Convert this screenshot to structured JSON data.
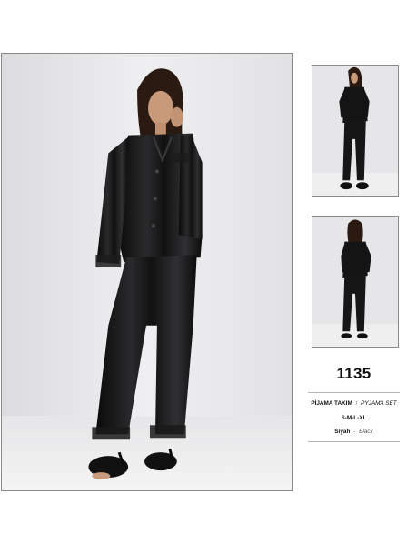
{
  "product": {
    "code": "1135",
    "name_tr": "PİJAMA TAKIM",
    "name_separator": "/",
    "name_en": "PYJAMA SET",
    "sizes": "S-M-L-XL",
    "color_tr": "Siyah",
    "color_separator": "-",
    "color_en": "Black"
  },
  "photos": {
    "main": "model-front-standing",
    "thumbnail_1": "model-front-full-body",
    "thumbnail_2": "model-back-full-body"
  },
  "colors": {
    "garment": "#121212",
    "backdrop": "#e9e9eb",
    "text": "#111111"
  }
}
